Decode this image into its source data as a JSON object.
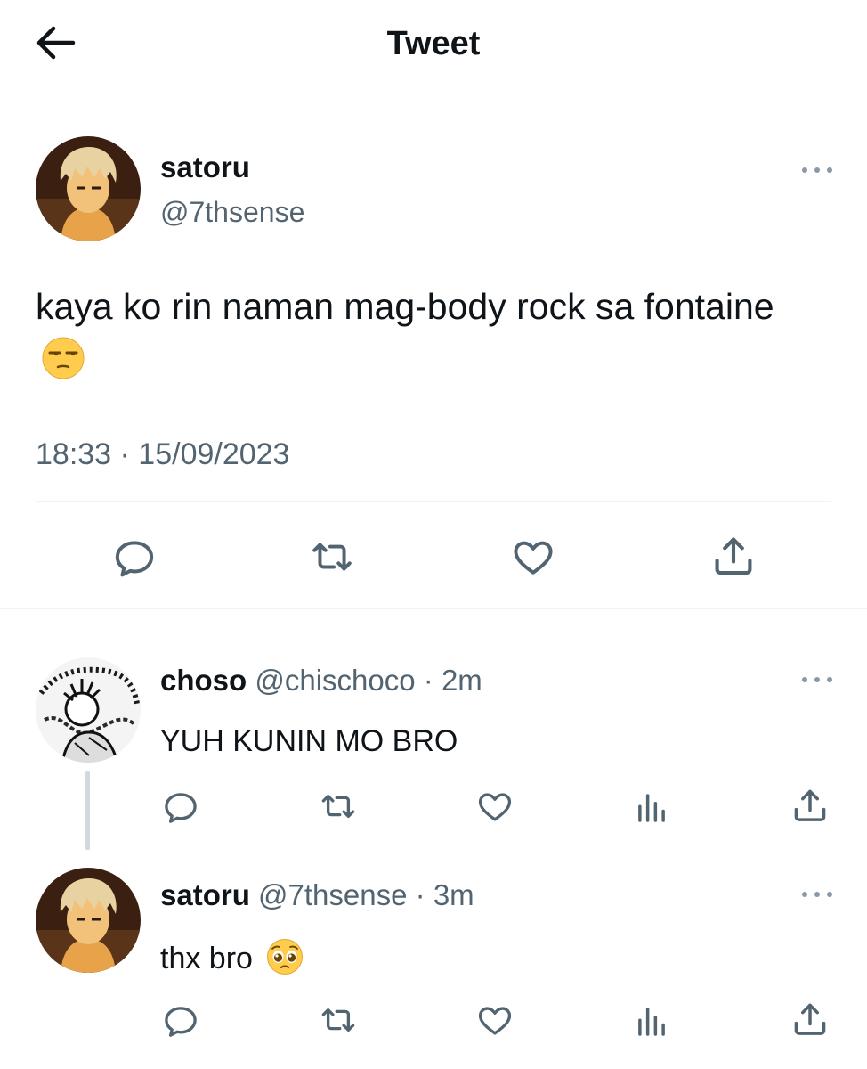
{
  "header": {
    "title": "Tweet",
    "back_icon": "arrow-left-icon"
  },
  "main_tweet": {
    "name": "satoru",
    "handle": "@7thsense",
    "text": "kaya ko rin naman mag-body rock sa fontaine",
    "emoji": "unamused-face",
    "timestamp": "18:33 · 15/09/2023",
    "actions": [
      "reply-icon",
      "retweet-icon",
      "like-icon",
      "share-icon"
    ]
  },
  "replies": [
    {
      "name": "choso",
      "handle": "@chischoco",
      "sep": "·",
      "time": "2m",
      "text": "YUH KUNIN MO BRO",
      "actions": [
        "reply-icon",
        "retweet-icon",
        "like-icon",
        "views-icon",
        "share-icon"
      ]
    },
    {
      "name": "satoru",
      "handle": "@7thsense",
      "sep": "·",
      "time": "3m",
      "text": "thx bro",
      "emoji": "pleading-face",
      "actions": [
        "reply-icon",
        "retweet-icon",
        "like-icon",
        "views-icon",
        "share-icon"
      ]
    }
  ],
  "colors": {
    "text": "#0f1419",
    "secondary": "#536471",
    "divider": "#eff3f4",
    "thread_line": "#cfd9de"
  }
}
